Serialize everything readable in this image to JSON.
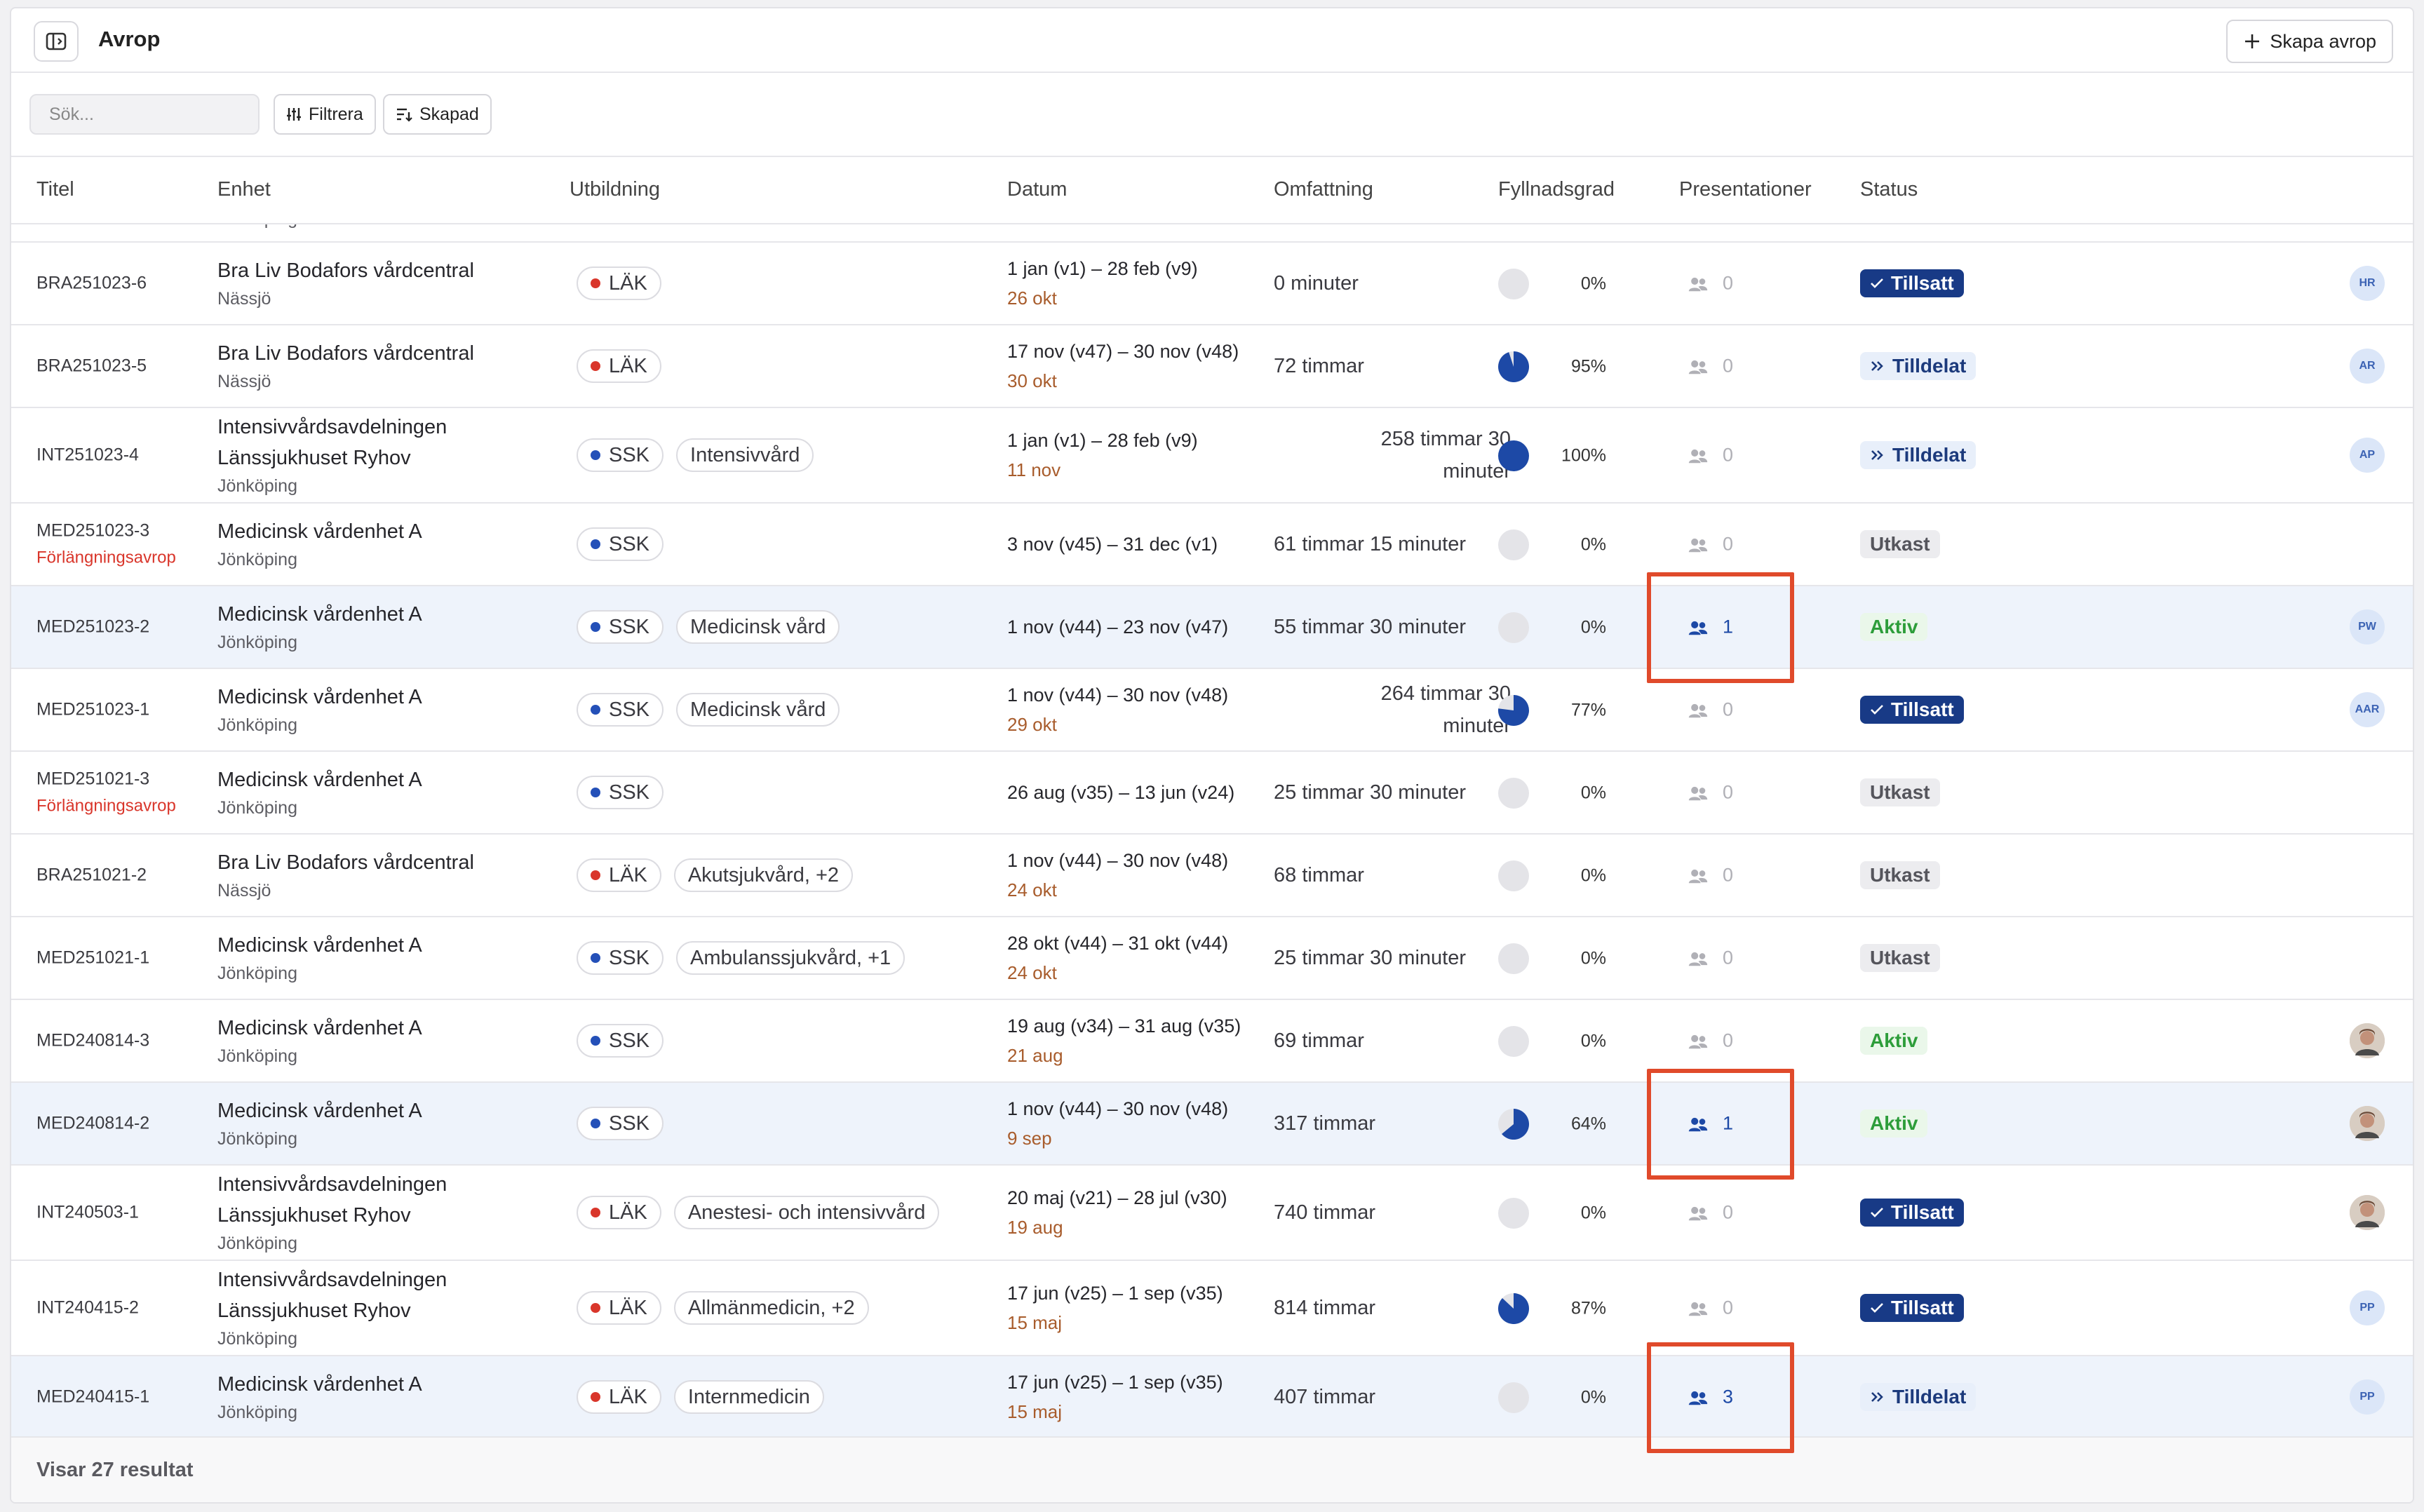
{
  "header": {
    "title": "Avrop",
    "create_label": "Skapa avrop"
  },
  "toolbar": {
    "search_placeholder": "Sök...",
    "filter_label": "Filtrera",
    "sort_label": "Skapad"
  },
  "columns": [
    "Titel",
    "Enhet",
    "Utbildning",
    "Datum",
    "Omfattning",
    "Fyllnadsgrad",
    "Presentationer",
    "Status"
  ],
  "sliver_text": "Jönköping",
  "rows": [
    {
      "id": "BRA251023-6",
      "unit": [
        "Bra Liv Bodafors vårdcentral"
      ],
      "city": "Nässjö",
      "edu": "LÄK",
      "eduColor": "#d9362b",
      "tags": [],
      "date": "1 jan (v1) – 28 feb (v9)",
      "sub": "26 okt",
      "omf": [
        "0 minuter"
      ],
      "fill": 0,
      "pctText": "0%",
      "pres": "0",
      "status": "Tillsatt",
      "statusType": "tillsatt",
      "avatar": "HR"
    },
    {
      "id": "BRA251023-5",
      "unit": [
        "Bra Liv Bodafors vårdcentral"
      ],
      "city": "Nässjö",
      "edu": "LÄK",
      "eduColor": "#d9362b",
      "tags": [],
      "date": "17 nov (v47) – 30 nov (v48)",
      "sub": "30 okt",
      "omf": [
        "72 timmar"
      ],
      "fill": 95,
      "pctText": "95%",
      "pres": "0",
      "status": "Tilldelat",
      "statusType": "tilldelat",
      "avatar": "AR"
    },
    {
      "id": "INT251023-4",
      "unit": [
        "Intensivvårdsavdelningen",
        "Länssjukhuset Ryhov"
      ],
      "city": "Jönköping",
      "edu": "SSK",
      "eduColor": "#2450b8",
      "tags": [
        "Intensivvård"
      ],
      "date": "1 jan (v1) – 28 feb (v9)",
      "sub": "11 nov",
      "omf": [
        "258 timmar 30",
        "minuter"
      ],
      "fill": 100,
      "pctText": "100%",
      "pres": "0",
      "status": "Tilldelat",
      "statusType": "tilldelat",
      "avatar": "AP"
    },
    {
      "id": "MED251023-3",
      "ext": "Förlängningsavrop",
      "unit": [
        "Medicinsk vårdenhet A"
      ],
      "city": "Jönköping",
      "edu": "SSK",
      "eduColor": "#2450b8",
      "tags": [],
      "date": "3 nov (v45) – 31 dec (v1)",
      "sub": "",
      "omf": [
        "61 timmar 15 minuter"
      ],
      "fill": 0,
      "pctText": "0%",
      "pres": "0",
      "status": "Utkast",
      "statusType": "utkast",
      "avatar": ""
    },
    {
      "id": "MED251023-2",
      "unit": [
        "Medicinsk vårdenhet A"
      ],
      "city": "Jönköping",
      "edu": "SSK",
      "eduColor": "#2450b8",
      "tags": [
        "Medicinsk vård"
      ],
      "date": "1 nov (v44) – 23 nov (v47)",
      "sub": "",
      "omf": [
        "55 timmar 30 minuter"
      ],
      "fill": 0,
      "pctText": "0%",
      "pres": "1",
      "status": "Aktiv",
      "statusType": "aktiv",
      "avatar": "PW",
      "hl": true
    },
    {
      "id": "MED251023-1",
      "unit": [
        "Medicinsk vårdenhet A"
      ],
      "city": "Jönköping",
      "edu": "SSK",
      "eduColor": "#2450b8",
      "tags": [
        "Medicinsk vård"
      ],
      "date": "1 nov (v44) – 30 nov (v48)",
      "sub": "29 okt",
      "omf": [
        "264 timmar 30",
        "minuter"
      ],
      "fill": 77,
      "pctText": "77%",
      "pres": "0",
      "status": "Tillsatt",
      "statusType": "tillsatt",
      "avatar": "AAR"
    },
    {
      "id": "MED251021-3",
      "ext": "Förlängningsavrop",
      "unit": [
        "Medicinsk vårdenhet A"
      ],
      "city": "Jönköping",
      "edu": "SSK",
      "eduColor": "#2450b8",
      "tags": [],
      "date": "26 aug (v35) – 13 jun (v24)",
      "sub": "",
      "omf": [
        "25 timmar 30 minuter"
      ],
      "fill": 0,
      "pctText": "0%",
      "pres": "0",
      "status": "Utkast",
      "statusType": "utkast",
      "avatar": ""
    },
    {
      "id": "BRA251021-2",
      "unit": [
        "Bra Liv Bodafors vårdcentral"
      ],
      "city": "Nässjö",
      "edu": "LÄK",
      "eduColor": "#d9362b",
      "tags": [
        "Akutsjukvård, +2"
      ],
      "date": "1 nov (v44) – 30 nov (v48)",
      "sub": "24 okt",
      "omf": [
        "68 timmar"
      ],
      "fill": 0,
      "pctText": "0%",
      "pres": "0",
      "status": "Utkast",
      "statusType": "utkast",
      "avatar": ""
    },
    {
      "id": "MED251021-1",
      "unit": [
        "Medicinsk vårdenhet A"
      ],
      "city": "Jönköping",
      "edu": "SSK",
      "eduColor": "#2450b8",
      "tags": [
        "Ambulanssjukvård, +1"
      ],
      "date": "28 okt (v44) – 31 okt (v44)",
      "sub": "24 okt",
      "omf": [
        "25 timmar 30 minuter"
      ],
      "fill": 0,
      "pctText": "0%",
      "pres": "0",
      "status": "Utkast",
      "statusType": "utkast",
      "avatar": ""
    },
    {
      "id": "MED240814-3",
      "unit": [
        "Medicinsk vårdenhet A"
      ],
      "city": "Jönköping",
      "edu": "SSK",
      "eduColor": "#2450b8",
      "tags": [],
      "date": "19 aug (v34) – 31 aug (v35)",
      "sub": "21 aug",
      "omf": [
        "69 timmar"
      ],
      "fill": 0,
      "pctText": "0%",
      "pres": "0",
      "status": "Aktiv",
      "statusType": "aktiv",
      "avatar": "photo"
    },
    {
      "id": "MED240814-2",
      "unit": [
        "Medicinsk vårdenhet A"
      ],
      "city": "Jönköping",
      "edu": "SSK",
      "eduColor": "#2450b8",
      "tags": [],
      "date": "1 nov (v44) – 30 nov (v48)",
      "sub": "9 sep",
      "omf": [
        "317 timmar"
      ],
      "fill": 64,
      "pctText": "64%",
      "pres": "1",
      "status": "Aktiv",
      "statusType": "aktiv",
      "avatar": "photo",
      "hl": true
    },
    {
      "id": "INT240503-1",
      "unit": [
        "Intensivvårdsavdelningen",
        "Länssjukhuset Ryhov"
      ],
      "city": "Jönköping",
      "edu": "LÄK",
      "eduColor": "#d9362b",
      "tags": [
        "Anestesi- och intensivvård"
      ],
      "date": "20 maj (v21) – 28 jul (v30)",
      "sub": "19 aug",
      "omf": [
        "740 timmar"
      ],
      "fill": 0,
      "pctText": "0%",
      "pres": "0",
      "status": "Tillsatt",
      "statusType": "tillsatt",
      "avatar": "photo"
    },
    {
      "id": "INT240415-2",
      "unit": [
        "Intensivvårdsavdelningen",
        "Länssjukhuset Ryhov"
      ],
      "city": "Jönköping",
      "edu": "LÄK",
      "eduColor": "#d9362b",
      "tags": [
        "Allmänmedicin, +2"
      ],
      "date": "17 jun (v25) – 1 sep (v35)",
      "sub": "15 maj",
      "omf": [
        "814 timmar"
      ],
      "fill": 87,
      "pctText": "87%",
      "pres": "0",
      "status": "Tillsatt",
      "statusType": "tillsatt",
      "avatar": "PP"
    },
    {
      "id": "MED240415-1",
      "unit": [
        "Medicinsk vårdenhet A"
      ],
      "city": "Jönköping",
      "edu": "LÄK",
      "eduColor": "#d9362b",
      "tags": [
        "Internmedicin"
      ],
      "date": "17 jun (v25) – 1 sep (v35)",
      "sub": "15 maj",
      "omf": [
        "407 timmar"
      ],
      "fill": 0,
      "pctText": "0%",
      "pres": "3",
      "status": "Tilldelat",
      "statusType": "tilldelat",
      "avatar": "PP",
      "hl": true
    }
  ],
  "footer": {
    "result_text": "Visar 27 resultat"
  },
  "colors": {
    "accent": "#183a86",
    "highlight": "#e04a2b",
    "danger": "#d9362b",
    "success": "#2d9d3a"
  }
}
